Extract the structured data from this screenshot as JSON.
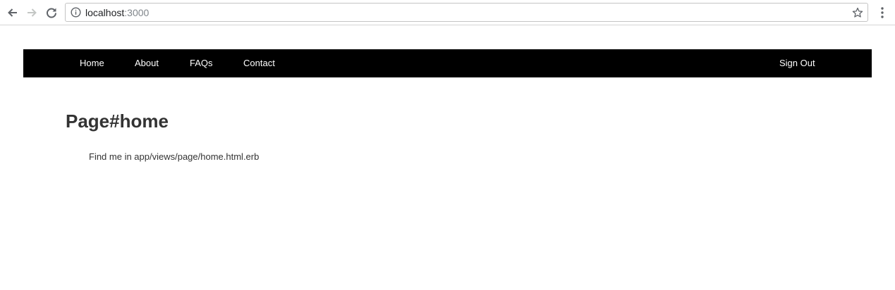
{
  "browser": {
    "url_host": "localhost",
    "url_port": ":3000",
    "icons": {
      "back": "back-arrow-icon",
      "forward": "forward-arrow-icon",
      "reload": "reload-icon",
      "info": "info-icon",
      "bookmark": "star-icon",
      "menu": "kebab-menu-icon"
    }
  },
  "navbar": {
    "background": "#000000",
    "link_color": "#ffffff",
    "links": [
      {
        "label": "Home"
      },
      {
        "label": "About"
      },
      {
        "label": "FAQs"
      },
      {
        "label": "Contact"
      }
    ],
    "sign_out_label": "Sign Out"
  },
  "main": {
    "title": "Page#home",
    "text": "Find me in app/views/page/home.html.erb"
  }
}
